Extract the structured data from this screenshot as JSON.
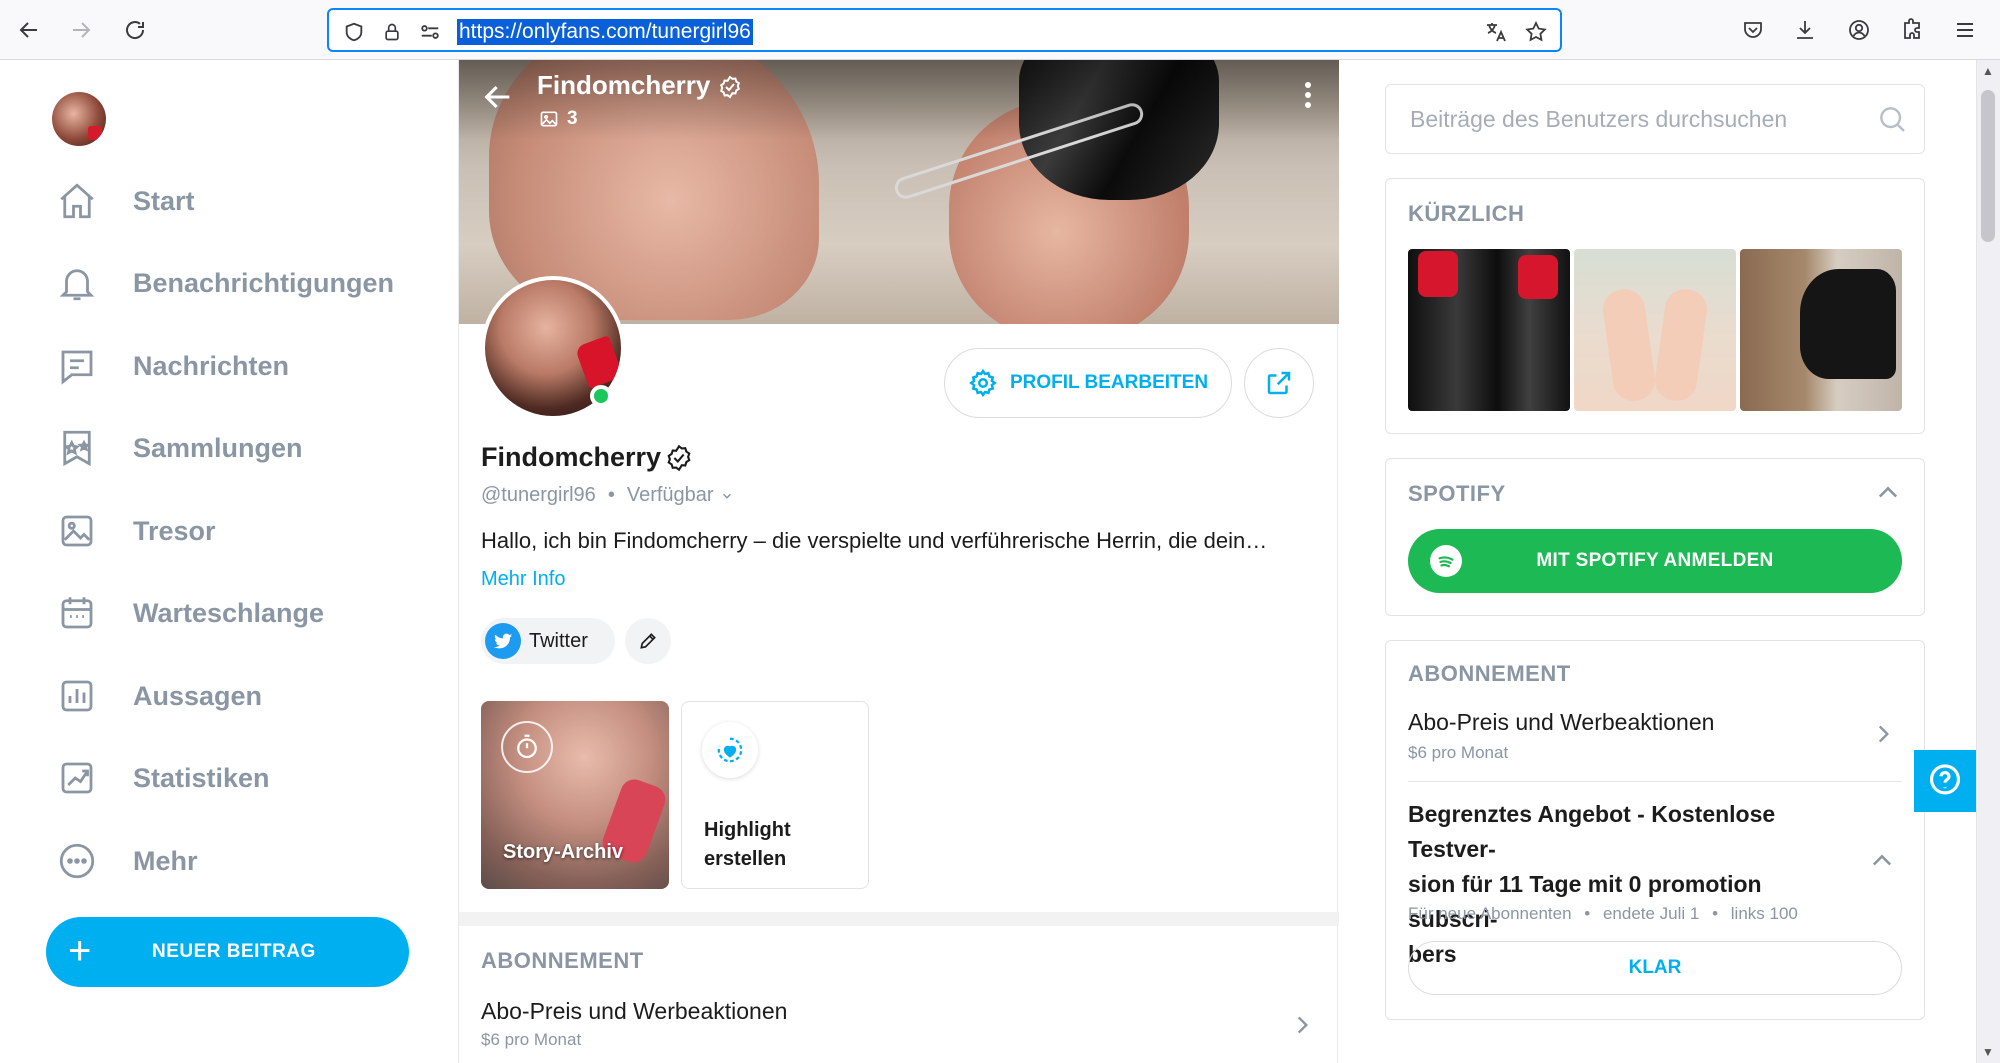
{
  "browser": {
    "url": "https://onlyfans.com/tunergirl96"
  },
  "sidebar": {
    "items": [
      {
        "label": "Start",
        "icon": "home-icon"
      },
      {
        "label": "Benachrichtigungen",
        "icon": "bell-icon"
      },
      {
        "label": "Nachrichten",
        "icon": "message-icon"
      },
      {
        "label": "Sammlungen",
        "icon": "collections-icon"
      },
      {
        "label": "Tresor",
        "icon": "vault-icon"
      },
      {
        "label": "Warteschlange",
        "icon": "calendar-icon"
      },
      {
        "label": "Aussagen",
        "icon": "statements-icon"
      },
      {
        "label": "Statistiken",
        "icon": "statistics-icon"
      },
      {
        "label": "Mehr",
        "icon": "more-icon"
      }
    ],
    "new_post_label": "NEUER BEITRAG"
  },
  "profile": {
    "cover_name": "Findomcherry",
    "media_count": "3",
    "name": "Findomcherry",
    "handle": "@tunergirl96",
    "status": "Verfügbar",
    "edit_label": "PROFIL BEARBEITEN",
    "bio": "Hallo, ich bin Findomcherry – die verspielte und verführerische Herrin, die dein…",
    "more_info": "Mehr Info",
    "twitter_label": "Twitter",
    "story_archive_label": "Story-Archiv",
    "highlight_label": "Highlight erstellen"
  },
  "center_subscription": {
    "title": "ABONNEMENT",
    "item_title": "Abo-Preis und Werbeaktionen",
    "item_sub": "$6 pro Monat"
  },
  "right": {
    "search_placeholder": "Beiträge des Benutzers durchsuchen",
    "recent_title": "KÜRZLICH",
    "spotify_title": "SPOTIFY",
    "spotify_button": "MIT SPOTIFY ANMELDEN",
    "subscription": {
      "title": "ABONNEMENT",
      "item_title": "Abo-Preis und Werbeaktionen",
      "item_sub": "$6 pro Monat",
      "offer_line1": "Begrenztes Angebot - Kostenlose Testver-",
      "offer_line2": "sion für 11 Tage mit 0 promotion subscri-",
      "offer_line3": "bers",
      "offer_meta_1": "Für neue Abonnenten",
      "offer_meta_2": "endete Juli 1",
      "offer_meta_3": "links 100",
      "klar_label": "KLAR"
    }
  },
  "colors": {
    "accent": "#00aff0",
    "spotify": "#1db954",
    "online": "#19c75a",
    "muted": "#8a96a3"
  }
}
